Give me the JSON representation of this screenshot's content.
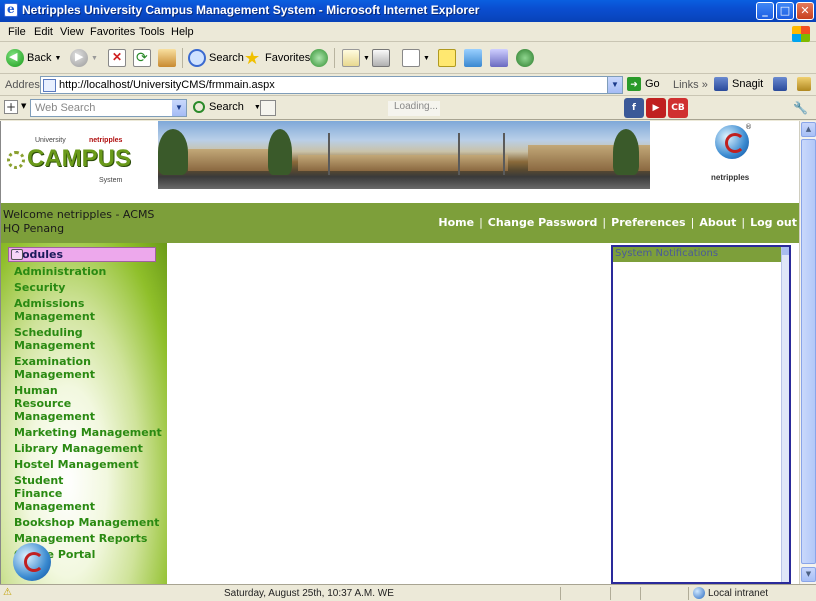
{
  "window": {
    "title": "Netripples University Campus Management System - Microsoft Internet Explorer",
    "controls": {
      "minimize": "_",
      "maximize": "□",
      "close": "✕"
    }
  },
  "menu": [
    "File",
    "Edit",
    "View",
    "Favorites",
    "Tools",
    "Help"
  ],
  "toolbar": {
    "back_label": "Back",
    "search_label": "Search",
    "favorites_label": "Favorites"
  },
  "address": {
    "label": "Address",
    "url": "http://localhost/UniversityCMS/frmmain.aspx",
    "go_label": "Go",
    "links_label": "Links",
    "snagit_label": "Snagit"
  },
  "search_toolbar": {
    "placeholder": "Web Search",
    "search_label": "Search",
    "loading_text": "Loading..."
  },
  "banner": {
    "logo": {
      "university": "University",
      "brand": "netripples",
      "campus": "CAMPUS",
      "system": "System"
    },
    "right_logo": "netripples"
  },
  "nav": {
    "welcome_line1": "Welcome netripples - ACMS",
    "welcome_line2": "HQ Penang",
    "links": [
      "Home",
      "Change Password",
      "Preferences",
      "About",
      "Log out"
    ]
  },
  "sidebar": {
    "header": "Modules",
    "items": [
      "Administration",
      "Security",
      "Admissions Management",
      "Scheduling Management",
      "Examination Management",
      "Human Resource Management",
      "Marketing Management",
      "Library Management",
      "Hostel Management",
      "Student Finance Management",
      "Bookshop Management",
      "Management Reports",
      "Online Portal"
    ]
  },
  "notifications": {
    "title": "System Notifications"
  },
  "status": {
    "datetime": "Saturday, August 25th,  10:37 A.M.   WE",
    "zone": "Local intranet"
  }
}
